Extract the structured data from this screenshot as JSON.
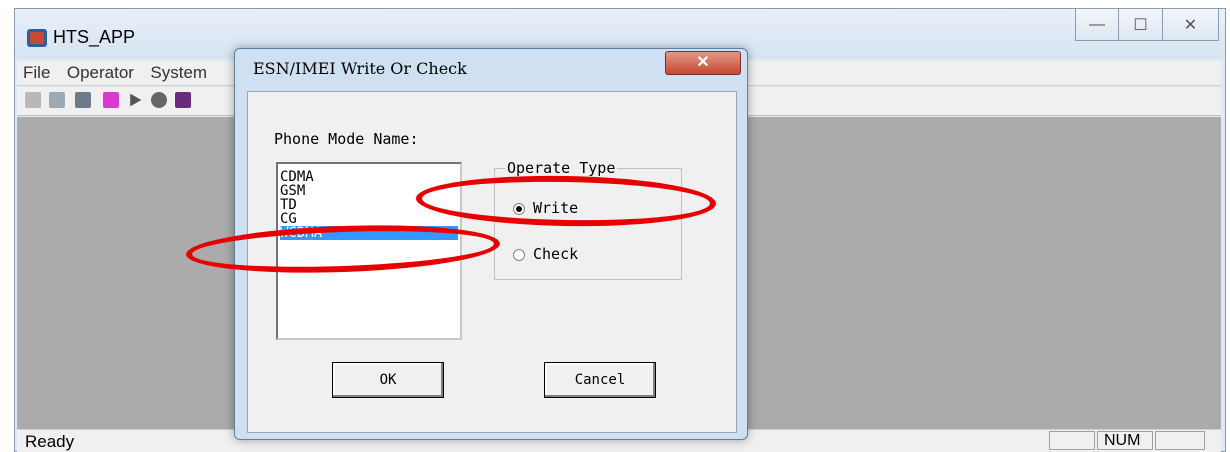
{
  "app": {
    "title": "HTS_APP",
    "window_buttons": {
      "minimize": "—",
      "maximize": "☐",
      "close": "✕"
    },
    "menu": [
      "File",
      "Operator",
      "System"
    ],
    "status": {
      "text": "Ready",
      "num": "NUM"
    }
  },
  "dialog": {
    "title": "ESN/IMEI Write Or Check",
    "close_glyph": "✕",
    "phone_mode_label": "Phone Mode Name:",
    "phone_modes": [
      "CDMA",
      "GSM",
      "TD",
      "CG",
      "WCDMA"
    ],
    "selected_mode": "WCDMA",
    "operate_type": {
      "title": "Operate Type",
      "options": [
        "Write",
        "Check"
      ],
      "selected": "Write"
    },
    "ok_label": "OK",
    "cancel_label": "Cancel"
  },
  "colors": {
    "annotation": "#e60000",
    "selection": "#3399ff",
    "workspace": "#ababab"
  },
  "icons": [
    "open-folder-icon",
    "properties-icon",
    "save-icon",
    "connect-icon",
    "play-icon",
    "record-icon",
    "toolbar-extra-icon"
  ]
}
